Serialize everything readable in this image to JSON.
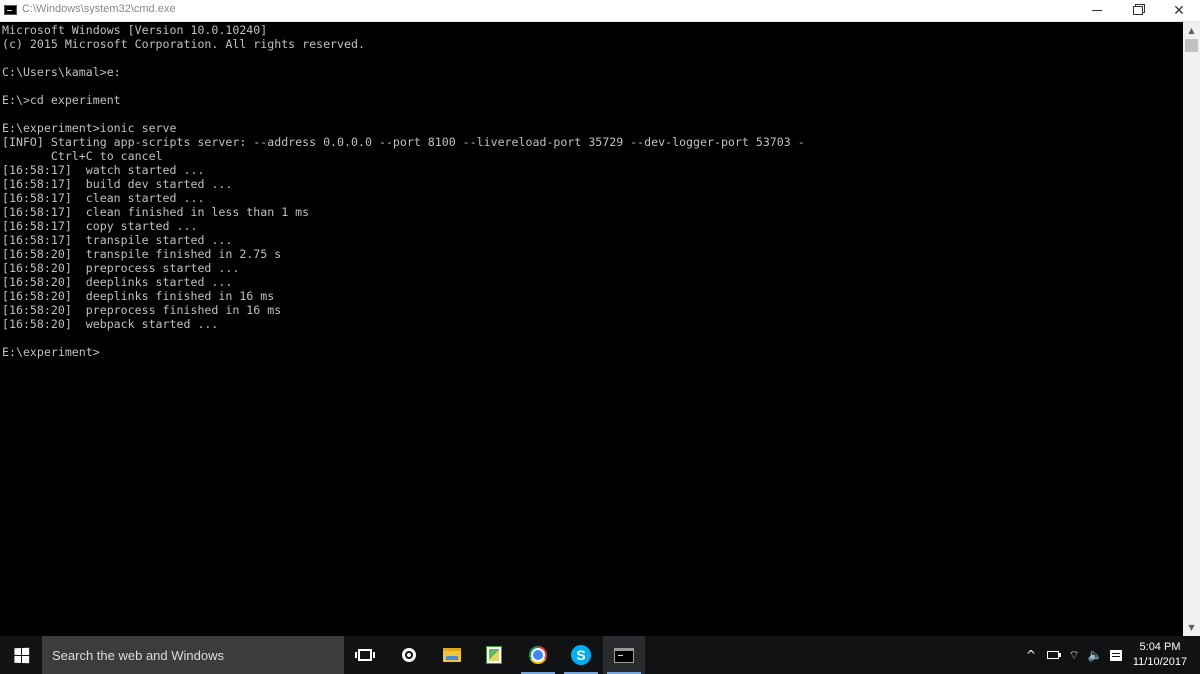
{
  "window": {
    "title": "C:\\Windows\\system32\\cmd.exe",
    "icon": "cmd-icon",
    "controls": {
      "minimize": "minimize-icon",
      "maximize": "restore-icon",
      "close": "✕"
    }
  },
  "console": {
    "lines": [
      "Microsoft Windows [Version 10.0.10240]",
      "(c) 2015 Microsoft Corporation. All rights reserved.",
      "",
      "C:\\Users\\kamal>e:",
      "",
      "E:\\>cd experiment",
      "",
      "E:\\experiment>ionic serve",
      "[INFO] Starting app-scripts server: --address 0.0.0.0 --port 8100 --livereload-port 35729 --dev-logger-port 53703 -",
      "       Ctrl+C to cancel",
      "[16:58:17]  watch started ...",
      "[16:58:17]  build dev started ...",
      "[16:58:17]  clean started ...",
      "[16:58:17]  clean finished in less than 1 ms",
      "[16:58:17]  copy started ...",
      "[16:58:17]  transpile started ...",
      "[16:58:20]  transpile finished in 2.75 s",
      "[16:58:20]  preprocess started ...",
      "[16:58:20]  deeplinks started ...",
      "[16:58:20]  deeplinks finished in 16 ms",
      "[16:58:20]  preprocess finished in 16 ms",
      "[16:58:20]  webpack started ...",
      "",
      "E:\\experiment>"
    ]
  },
  "taskbar": {
    "search_placeholder": "Search the web and Windows",
    "pinned": [
      "task-view-icon",
      "cortana-icon",
      "file-explorer-icon",
      "paint-icon",
      "chrome-icon",
      "skype-icon",
      "cmd-icon"
    ],
    "skype_glyph": "S",
    "tray": {
      "chevron": "^",
      "wifi_glyph": "⌔",
      "volume_glyph": "🔈"
    },
    "clock": {
      "time": "5:04 PM",
      "date": "11/10/2017"
    }
  },
  "colors": {
    "console_bg": "#000000",
    "console_text": "#c0c0c0",
    "taskbar_bg": "#111214",
    "search_bg": "#3b3c3e"
  }
}
